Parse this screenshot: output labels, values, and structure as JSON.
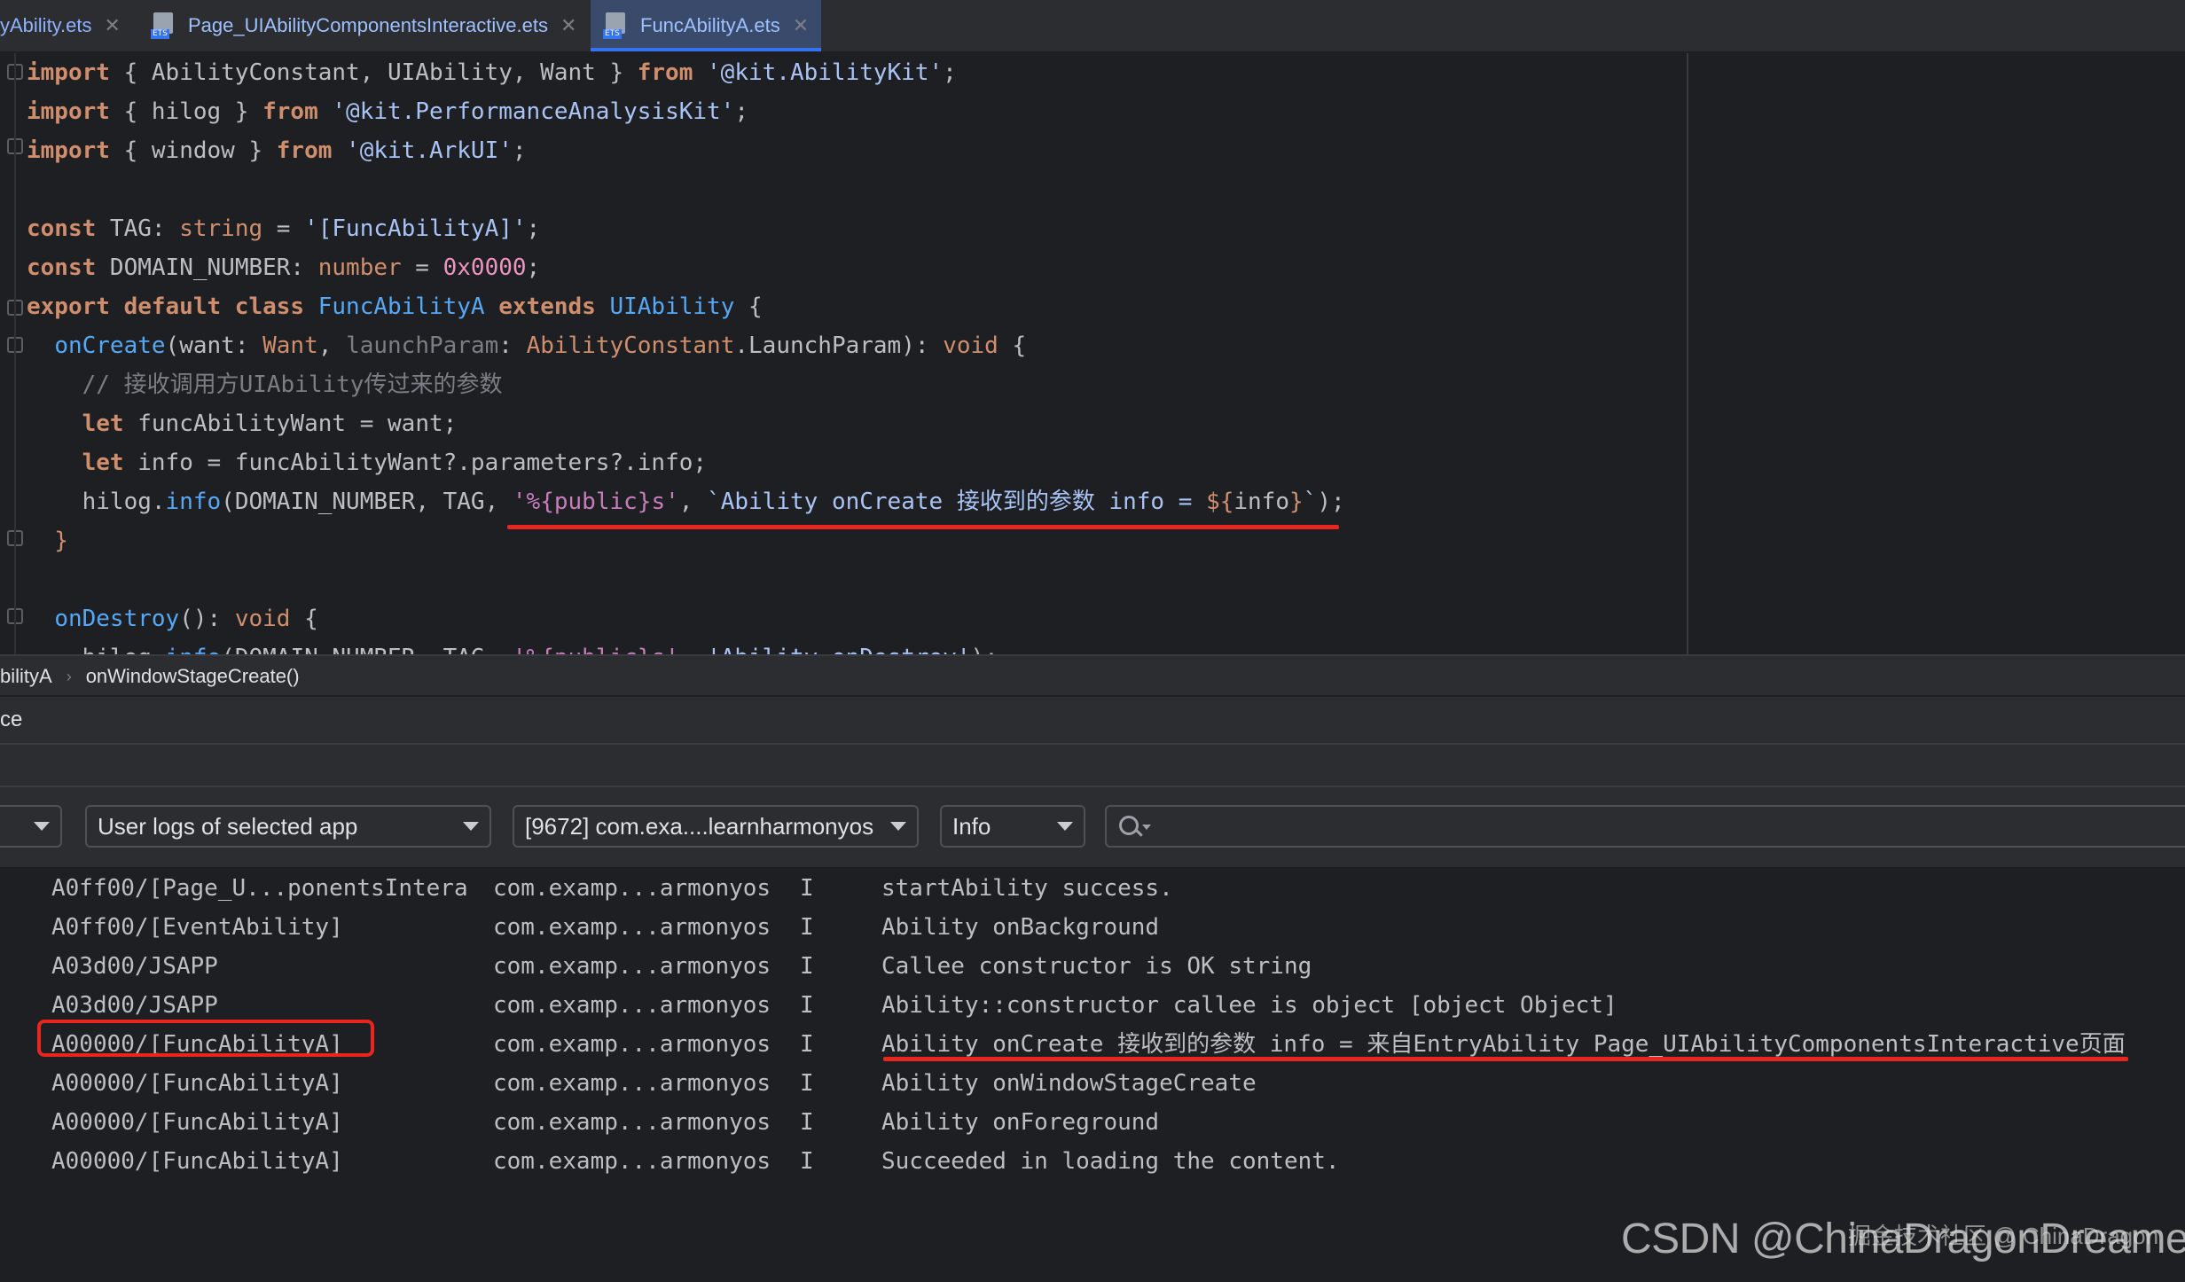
{
  "tabs": [
    {
      "label": "yAbility.ets",
      "active": false,
      "icon": false
    },
    {
      "label": "Page_UIAbilityComponentsInteractive.ets",
      "active": false,
      "icon": true
    },
    {
      "label": "FuncAbilityA.ets",
      "active": true,
      "icon": true
    }
  ],
  "tab_close": "✕",
  "file_icon_label": "ETS",
  "code": {
    "l1": {
      "a": "import",
      "b": " { AbilityConstant, UIAbility, Want } ",
      "c": "from",
      "d": " ",
      "e": "'@kit.AbilityKit'",
      "f": ";"
    },
    "l2": {
      "a": "import",
      "b": " { hilog } ",
      "c": "from",
      "d": " ",
      "e": "'@kit.PerformanceAnalysisKit'",
      "f": ";"
    },
    "l3": {
      "a": "import",
      "b": " { window } ",
      "c": "from",
      "d": " ",
      "e": "'@kit.ArkUI'",
      "f": ";"
    },
    "l5": {
      "a": "const",
      "b": " TAG: ",
      "c": "string",
      "d": " = ",
      "e": "'[FuncAbilityA]'",
      "f": ";"
    },
    "l6": {
      "a": "const",
      "b": " DOMAIN_NUMBER: ",
      "c": "number",
      "d": " = ",
      "e": "0x0000",
      "f": ";"
    },
    "l7": {
      "a": "export default class",
      "b": " ",
      "c": "FuncAbilityA",
      "d": " ",
      "e": "extends",
      "f": " ",
      "g": "UIAbility",
      "h": " {"
    },
    "l8": {
      "a": "  ",
      "b": "onCreate",
      "c": "(want: ",
      "d": "Want",
      "e": ", ",
      "f": "launchParam",
      "g": ": ",
      "h": "AbilityConstant",
      "i": ".LaunchParam): ",
      "j": "void",
      "k": " {"
    },
    "l9": {
      "a": "    // 接收调用方UIAbility传过来的参数"
    },
    "l10": {
      "a": "    ",
      "b": "let",
      "c": " funcAbilityWant = want;"
    },
    "l11": {
      "a": "    ",
      "b": "let",
      "c": " info = funcAbilityWant?.parameters?.info;"
    },
    "l12": {
      "a": "    hilog.",
      "b": "info",
      "c": "(DOMAIN_NUMBER, TAG, ",
      "d": "'%{public}s'",
      "e": ", ",
      "f": "`Ability onCreate 接收到的参数 info = ",
      "g": "${",
      "h": "info",
      "i": "}",
      "j": "`",
      "k": ");"
    },
    "l13": {
      "a": "  }"
    },
    "l15": {
      "a": "  ",
      "b": "onDestroy",
      "c": "(): ",
      "d": "void",
      "e": " {"
    },
    "l16": {
      "a": "    hilog.",
      "b": "info",
      "c": "(DOMAIN_NUMBER, TAG, ",
      "d": "'%{public}s'",
      "e": ", ",
      "f": "'Ability onDestroy'",
      "g": ");"
    }
  },
  "breadcrumb": {
    "class": "bilityA",
    "method": "onWindowStageCreate()"
  },
  "panel": {
    "title": "ce"
  },
  "filters": {
    "first_value": "",
    "log_source": "User logs of selected app",
    "process": "[9672] com.exa....learnharmonyos",
    "level": "Info",
    "search_value": ""
  },
  "logs": [
    {
      "tag": "A0ff00/[Page_U...ponentsIntera",
      "pkg": "com.examp...armonyos",
      "lvl": "I",
      "msg": "startAbility success."
    },
    {
      "tag": "A0ff00/[EventAbility]",
      "pkg": "com.examp...armonyos",
      "lvl": "I",
      "msg": "Ability onBackground"
    },
    {
      "tag": "A03d00/JSAPP",
      "pkg": "com.examp...armonyos",
      "lvl": "I",
      "msg": "Callee constructor is OK string"
    },
    {
      "tag": "A03d00/JSAPP",
      "pkg": "com.examp...armonyos",
      "lvl": "I",
      "msg": "Ability::constructor callee is object [object Object]"
    },
    {
      "tag": "A00000/[FuncAbilityA]",
      "pkg": "com.examp...armonyos",
      "lvl": "I",
      "msg": "Ability onCreate 接收到的参数 info = 来自EntryAbility Page_UIAbilityComponentsInteractive页面"
    },
    {
      "tag": "A00000/[FuncAbilityA]",
      "pkg": "com.examp...armonyos",
      "lvl": "I",
      "msg": "Ability onWindowStageCreate"
    },
    {
      "tag": "A00000/[FuncAbilityA]",
      "pkg": "com.examp...armonyos",
      "lvl": "I",
      "msg": "Ability onForeground"
    },
    {
      "tag": "A00000/[FuncAbilityA]",
      "pkg": "com.examp...armonyos",
      "lvl": "I",
      "msg": "Succeeded in loading the content."
    }
  ],
  "watermark": {
    "main": "CSDN @ChinaDragonDreamer",
    "secondary": "掘金技术社区 @ ChinaDragon"
  },
  "colors": {
    "highlight_red": "#e8261f",
    "accent_blue": "#3574f0"
  }
}
